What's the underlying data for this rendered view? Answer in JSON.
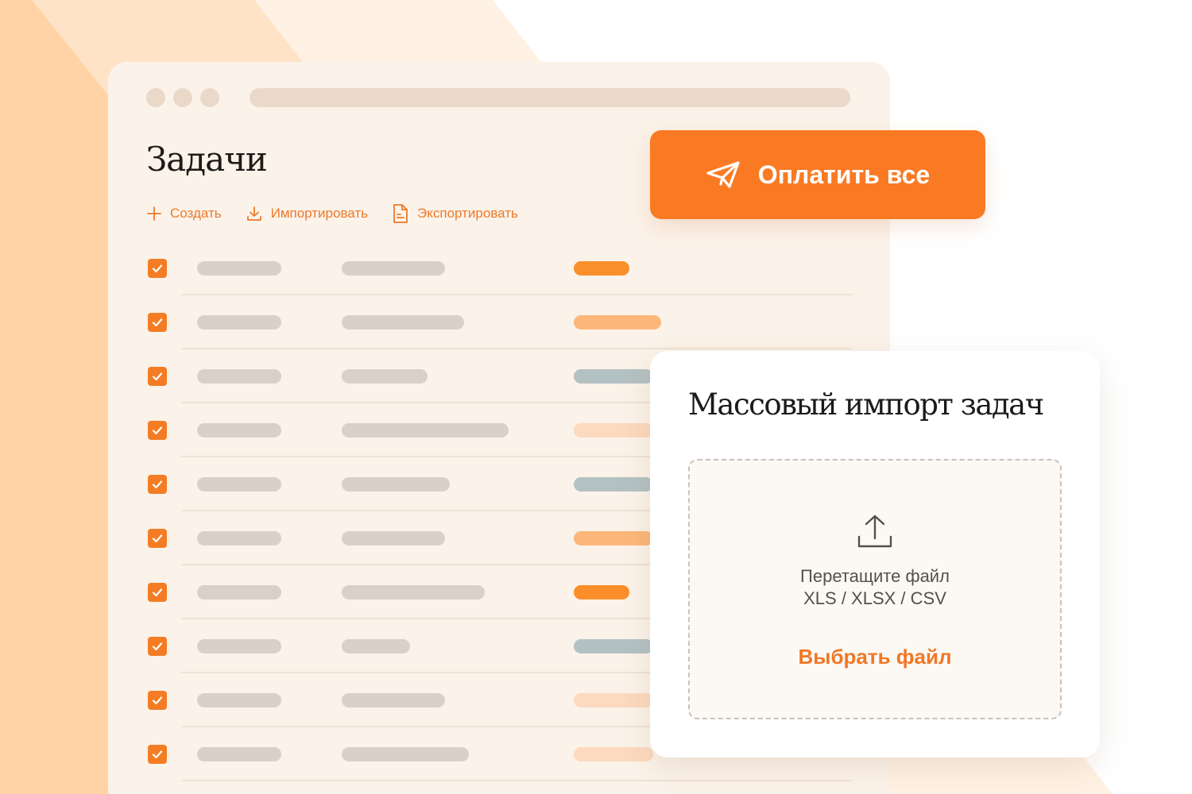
{
  "colors": {
    "accent": "#fa7a24",
    "checkbox": "#f47c24",
    "placeholder": "#d9d0c9",
    "status_orange": "#fa8f2a",
    "status_light_orange": "#fdb77a",
    "status_pale": "#fcd9bf",
    "status_gray": "#b4c1c3"
  },
  "window": {
    "title": "Задачи",
    "toolbar": [
      {
        "label": "Создать",
        "icon": "plus-icon"
      },
      {
        "label": "Импортировать",
        "icon": "download-icon"
      },
      {
        "label": "Экспортировать",
        "icon": "file-icon"
      }
    ],
    "rows": [
      {
        "checked": true,
        "status_color": "#fa8f2a"
      },
      {
        "checked": true,
        "status_color": "#fdb77a"
      },
      {
        "checked": true,
        "status_color": "#b4c1c3"
      },
      {
        "checked": true,
        "status_color": "#fcd9bf"
      },
      {
        "checked": true,
        "status_color": "#b4c1c3"
      },
      {
        "checked": true,
        "status_color": "#fdb77a"
      },
      {
        "checked": true,
        "status_color": "#fa8f2a"
      },
      {
        "checked": true,
        "status_color": "#b4c1c3"
      },
      {
        "checked": true,
        "status_color": "#fcd9bf"
      },
      {
        "checked": true,
        "status_color": "#fcd9bf"
      }
    ]
  },
  "pay_button": {
    "label": "Оплатить все",
    "icon": "paper-plane-icon"
  },
  "import_panel": {
    "title": "Массовый импорт задач",
    "drop_text_line1": "Перетащите файл",
    "drop_text_line2": "XLS / XLSX / CSV",
    "choose_label": "Выбрать файл",
    "icon": "upload-icon"
  }
}
